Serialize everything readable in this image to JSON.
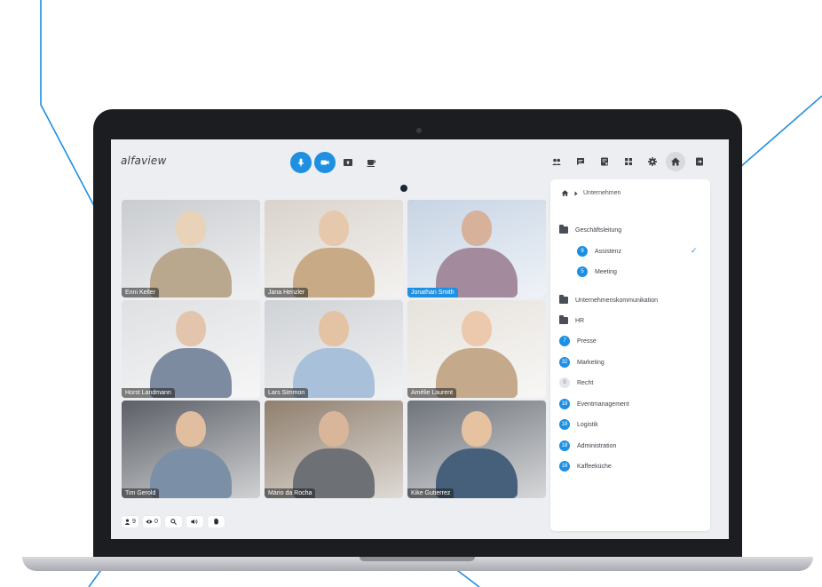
{
  "app": {
    "logo": "alfaview",
    "accent_color": "#1e8fe1"
  },
  "toolbar": {
    "center": [
      {
        "icon": "microphone-icon",
        "active": true
      },
      {
        "icon": "camera-icon",
        "active": true
      },
      {
        "icon": "screen-share-icon",
        "active": false
      },
      {
        "icon": "coffee-break-icon",
        "active": false
      }
    ],
    "right": [
      {
        "icon": "participants-icon"
      },
      {
        "icon": "chat-icon"
      },
      {
        "icon": "files-icon"
      },
      {
        "icon": "apps-icon"
      },
      {
        "icon": "settings-icon"
      },
      {
        "icon": "home-icon",
        "active": true
      },
      {
        "icon": "exit-icon"
      }
    ]
  },
  "video_grid": {
    "tiles": [
      {
        "name": "Enni Keller",
        "speaking": false
      },
      {
        "name": "Jana Henzler",
        "speaking": false
      },
      {
        "name": "Jonathan Smith",
        "speaking": true
      },
      {
        "name": "Horst Landmann",
        "speaking": false
      },
      {
        "name": "Lars Simmon",
        "speaking": false
      },
      {
        "name": "Amélie Laurent",
        "speaking": false
      },
      {
        "name": "Tim Gerold",
        "speaking": false
      },
      {
        "name": "Mário da Rocha",
        "speaking": false
      },
      {
        "name": "Kike Gutierrez",
        "speaking": false
      }
    ]
  },
  "status_bar": {
    "participants_count": "9",
    "viewers_count": "0",
    "icons": [
      "participants-icon",
      "eye-icon",
      "zoom-icon",
      "speaker-icon",
      "hand-icon"
    ]
  },
  "room_panel": {
    "breadcrumb": "Unternehmen",
    "rooms": [
      {
        "type": "folder",
        "label": "Geschäftsleitung"
      },
      {
        "type": "room",
        "count": "9",
        "label": "Assistenz",
        "active": true,
        "indent": true
      },
      {
        "type": "room",
        "count": "5",
        "label": "Meeting",
        "indent": true
      },
      {
        "type": "folder",
        "label": "Unternehmenskommunikation"
      },
      {
        "type": "folder",
        "label": "HR"
      },
      {
        "type": "room",
        "count": "7",
        "label": "Presse"
      },
      {
        "type": "room",
        "count": "32",
        "label": "Marketing"
      },
      {
        "type": "room",
        "count": "0",
        "label": "Recht"
      },
      {
        "type": "room",
        "count": "18",
        "label": "Eventmanagement"
      },
      {
        "type": "room",
        "count": "18",
        "label": "Logistik"
      },
      {
        "type": "room",
        "count": "18",
        "label": "Administration"
      },
      {
        "type": "room",
        "count": "18",
        "label": "Kaffeeküche"
      }
    ]
  }
}
